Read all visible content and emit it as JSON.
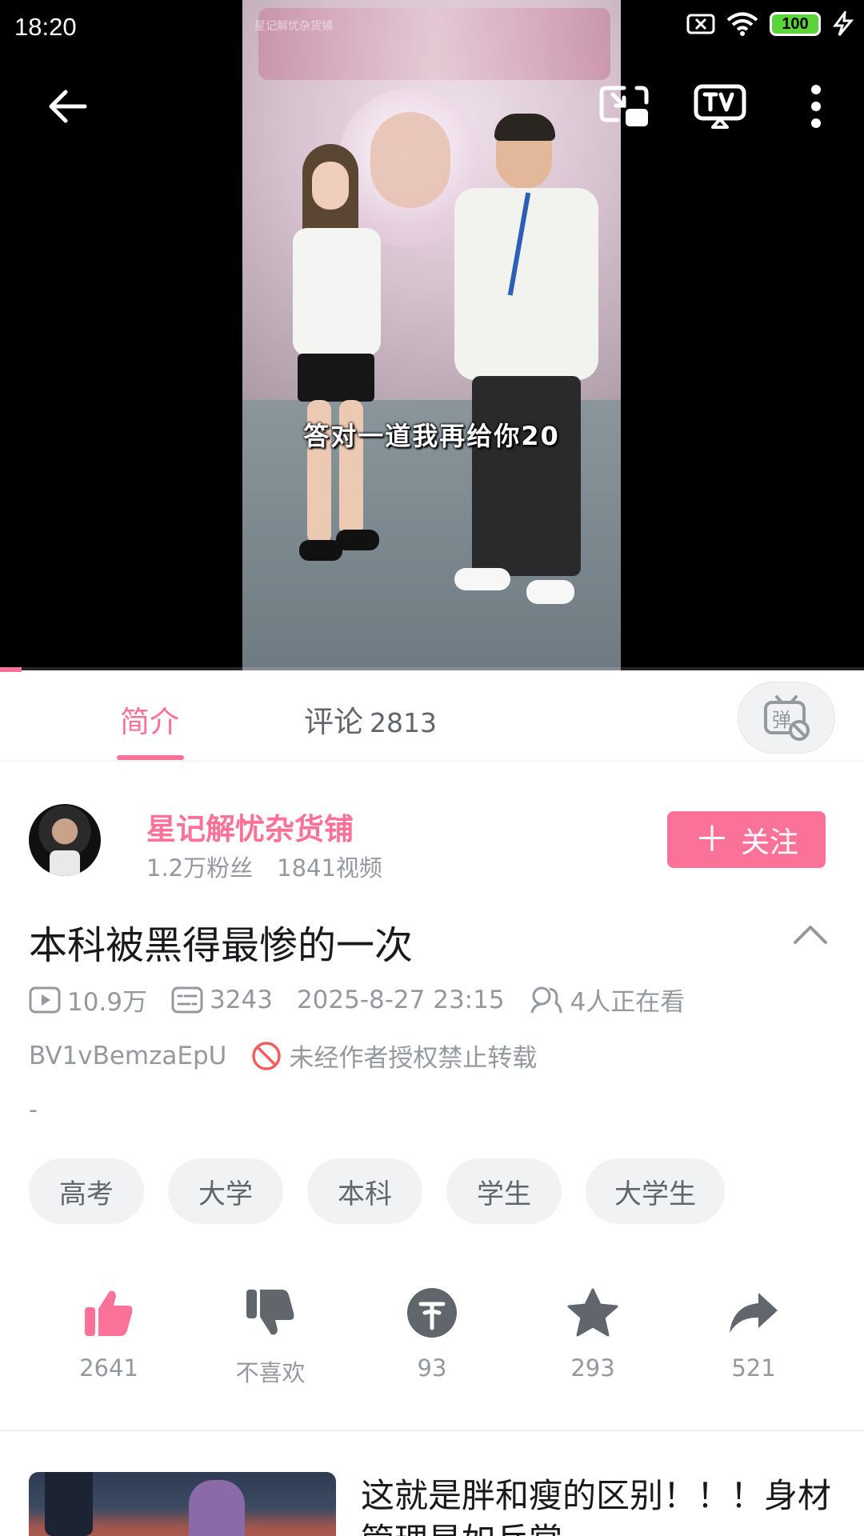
{
  "status_bar": {
    "time": "18:20",
    "battery": "100"
  },
  "video": {
    "subtitle": "答对一道我再给你20",
    "watermark": "星记解忧杂货铺",
    "progress": 0.025
  },
  "tabs": {
    "intro_label": "简介",
    "comment_label": "评论",
    "comment_count": "2813"
  },
  "uploader": {
    "name": "星记解忧杂货铺",
    "fans": "1.2万粉丝",
    "videos": "1841视频",
    "follow_label": "关注"
  },
  "video_info": {
    "title": "本科被黑得最惨的一次",
    "views": "10.9万",
    "danmaku_count": "3243",
    "publish_time": "2025-8-27 23:15",
    "watching": "4人正在看",
    "bvid": "BV1vBemzaEpU",
    "copyright": "未经作者授权禁止转载",
    "description": "-"
  },
  "tags": [
    "高考",
    "大学",
    "本科",
    "学生",
    "大学生"
  ],
  "actions": {
    "like": "2641",
    "dislike": "不喜欢",
    "coin": "93",
    "favorite": "293",
    "share": "521"
  },
  "colors": {
    "accent": "#fb7299",
    "text_gray": "#9499a0",
    "icon_dark": "#61666d"
  },
  "related": [
    {
      "title": "这就是胖和瘦的区别！！！身材管理是如乒掌"
    }
  ]
}
